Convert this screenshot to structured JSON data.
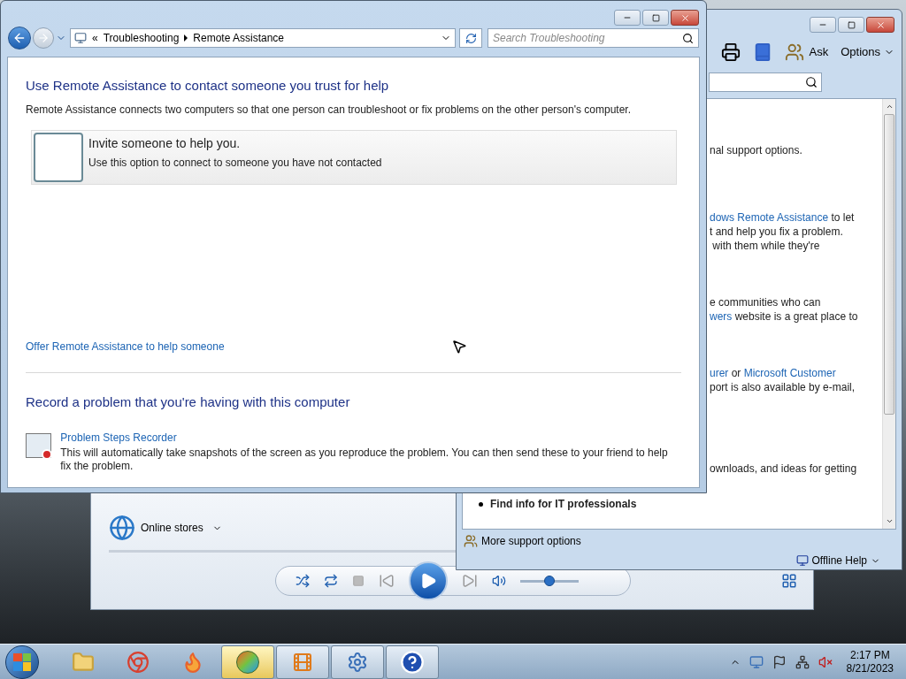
{
  "troubleshooting_window": {
    "breadcrumb_prefix": "«",
    "breadcrumb": [
      "Troubleshooting",
      "Remote Assistance"
    ],
    "search": {
      "placeholder": "Search Troubleshooting"
    },
    "section_1": {
      "heading": "Use Remote Assistance to contact someone you trust for help",
      "description": "Remote Assistance connects two computers so that one person can troubleshoot or fix problems on the other person's computer.",
      "option": {
        "title": "Invite someone to help you.",
        "subtitle": "Use this option to connect to someone you have not contacted"
      },
      "link": "Offer Remote Assistance to help someone"
    },
    "section_2": {
      "heading": "Record a problem that you're having with this computer",
      "tool": {
        "title": "Problem Steps Recorder",
        "description": "This will automatically take snapshots of the screen as you reproduce the problem. You can then send these to your friend to help fix the problem."
      }
    }
  },
  "help_window": {
    "toolbar": [
      "Ask",
      "Options"
    ],
    "paragraphs": [
      {
        "kind": "text",
        "lines": [
          [
            {
              "text": "nal support options.",
              "link": false
            }
          ]
        ]
      },
      {
        "kind": "text",
        "lines": [
          [
            {
              "text": "dows Remote Assistance",
              "link": true
            },
            {
              "text": " to let",
              "link": false
            }
          ],
          [
            {
              "text": "t and help you fix a problem.",
              "link": false
            }
          ],
          [
            {
              "text": " with them while they're",
              "link": false
            }
          ]
        ]
      },
      {
        "kind": "text",
        "lines": [
          [
            {
              "text": "e communities who can",
              "link": false
            }
          ],
          [
            {
              "text": "wers",
              "link": true
            },
            {
              "text": " website is a great place to",
              "link": false
            }
          ]
        ]
      },
      {
        "kind": "text",
        "lines": [
          [
            {
              "text": "urer",
              "link": true
            },
            {
              "text": " or ",
              "link": false
            },
            {
              "text": "Microsoft Customer",
              "link": true
            }
          ],
          [
            {
              "text": "port is also available by e-mail,",
              "link": false
            }
          ]
        ]
      },
      {
        "kind": "text",
        "lines": [
          [
            {
              "text": "ownloads, and ideas for getting",
              "link": false
            }
          ]
        ]
      },
      {
        "kind": "bullet",
        "lines": [
          [
            {
              "text": "Find info for IT professionals",
              "link": false
            }
          ]
        ]
      }
    ],
    "more_support": "More support options",
    "offline_help": "Offline Help"
  },
  "media_player": {
    "online_stores": "Online stores",
    "volume": {
      "level": 0.5
    }
  },
  "taskbar": {
    "apps": [
      {
        "kind": "explorer",
        "selected": false,
        "running": false
      },
      {
        "kind": "chrome",
        "selected": false,
        "running": false
      },
      {
        "kind": "firefox",
        "selected": false,
        "running": false
      },
      {
        "kind": "windows",
        "selected": true,
        "running": true
      },
      {
        "kind": "media",
        "selected": false,
        "running": true
      },
      {
        "kind": "control",
        "selected": false,
        "running": true
      },
      {
        "kind": "help",
        "selected": false,
        "running": true
      }
    ],
    "clock": {
      "time": "2:17 PM",
      "date": "8/21/2023"
    }
  }
}
